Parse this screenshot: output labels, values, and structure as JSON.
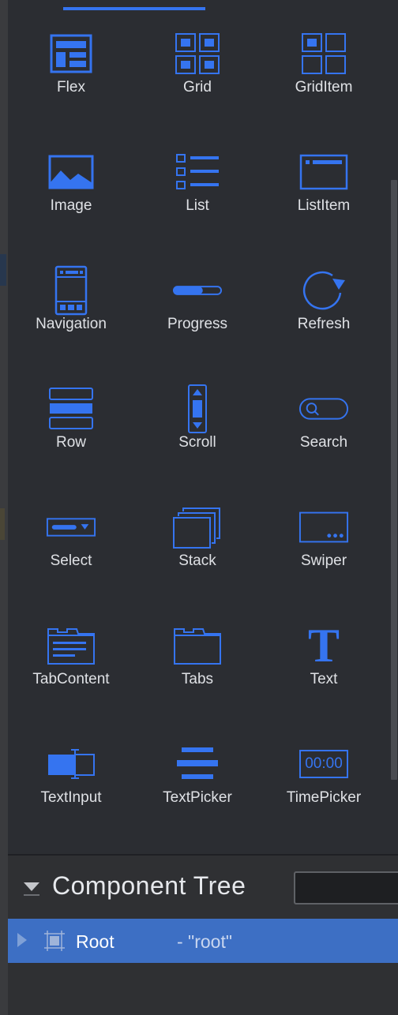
{
  "palette": {
    "components": [
      {
        "label": "Flex",
        "icon": "flex-icon"
      },
      {
        "label": "Grid",
        "icon": "grid-icon"
      },
      {
        "label": "GridItem",
        "icon": "grid-item-icon"
      },
      {
        "label": "Image",
        "icon": "image-icon"
      },
      {
        "label": "List",
        "icon": "list-icon"
      },
      {
        "label": "ListItem",
        "icon": "list-item-icon"
      },
      {
        "label": "Navigation",
        "icon": "navigation-icon"
      },
      {
        "label": "Progress",
        "icon": "progress-icon"
      },
      {
        "label": "Refresh",
        "icon": "refresh-icon"
      },
      {
        "label": "Row",
        "icon": "row-icon"
      },
      {
        "label": "Scroll",
        "icon": "scroll-icon"
      },
      {
        "label": "Search",
        "icon": "search-icon"
      },
      {
        "label": "Select",
        "icon": "select-icon"
      },
      {
        "label": "Stack",
        "icon": "stack-icon"
      },
      {
        "label": "Swiper",
        "icon": "swiper-icon"
      },
      {
        "label": "TabContent",
        "icon": "tab-content-icon"
      },
      {
        "label": "Tabs",
        "icon": "tabs-icon"
      },
      {
        "label": "Text",
        "icon": "text-icon"
      },
      {
        "label": "TextInput",
        "icon": "text-input-icon"
      },
      {
        "label": "TextPicker",
        "icon": "text-picker-icon"
      },
      {
        "label": "TimePicker",
        "icon": "time-picker-icon"
      }
    ],
    "time_picker_display": "00:00",
    "text_glyph": "T"
  },
  "component_tree": {
    "title": "Component Tree",
    "root": {
      "label": "Root",
      "id": "- \"root\""
    }
  },
  "colors": {
    "accent": "#3574f0",
    "panel_bg": "#2b2d32",
    "selection": "#3d6fc4",
    "label_text": "#dfe1e5"
  }
}
